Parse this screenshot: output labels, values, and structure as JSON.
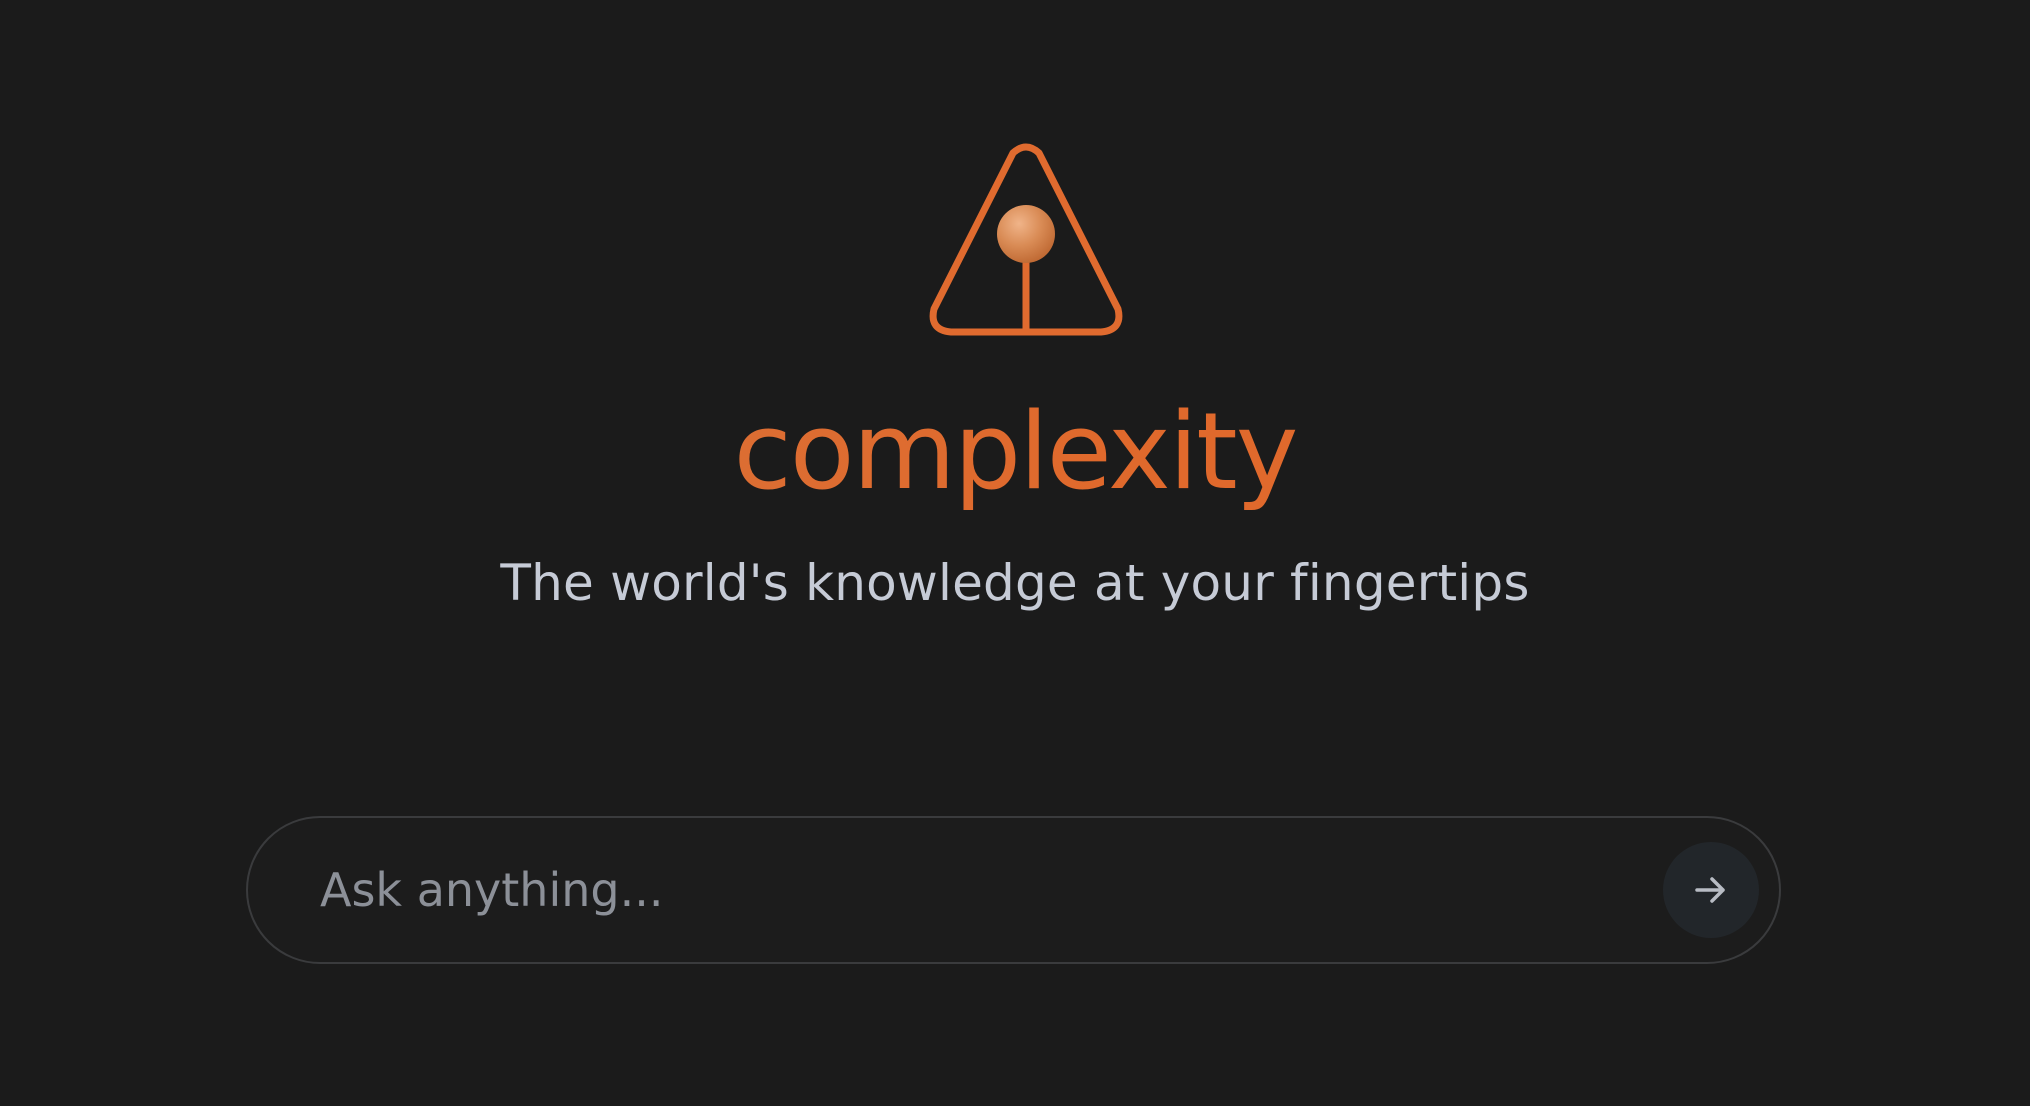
{
  "logo": {
    "icon": "triangle-lightbulb-logo-icon",
    "accent_color": "#e06b2f"
  },
  "brand": {
    "name": "complexity"
  },
  "tagline": "The world's knowledge at your fingertips",
  "search": {
    "placeholder": "Ask anything...",
    "value": "",
    "submit_icon": "arrow-right-icon"
  },
  "colors": {
    "background": "#1b1b1b",
    "accent": "#e06b2f",
    "tagline": "#c6cbd6",
    "placeholder": "#8c9098",
    "border": "#3a3b3d",
    "button_bg": "#22262a"
  }
}
